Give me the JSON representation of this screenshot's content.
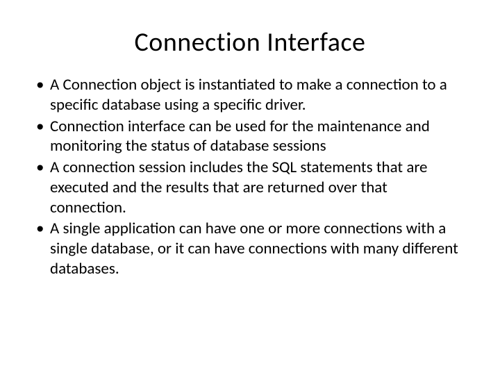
{
  "slide": {
    "title": "Connection Interface",
    "bullets": [
      "A Connection object is instantiated to make a connection to a specific database using a specific driver.",
      "Connection interface can be used for the maintenance and monitoring the status of database sessions",
      "A connection session includes the SQL statements that are executed and the results that are returned over that connection.",
      "A single application can have one or more connections with a single database, or it can have connections with many different databases."
    ]
  }
}
